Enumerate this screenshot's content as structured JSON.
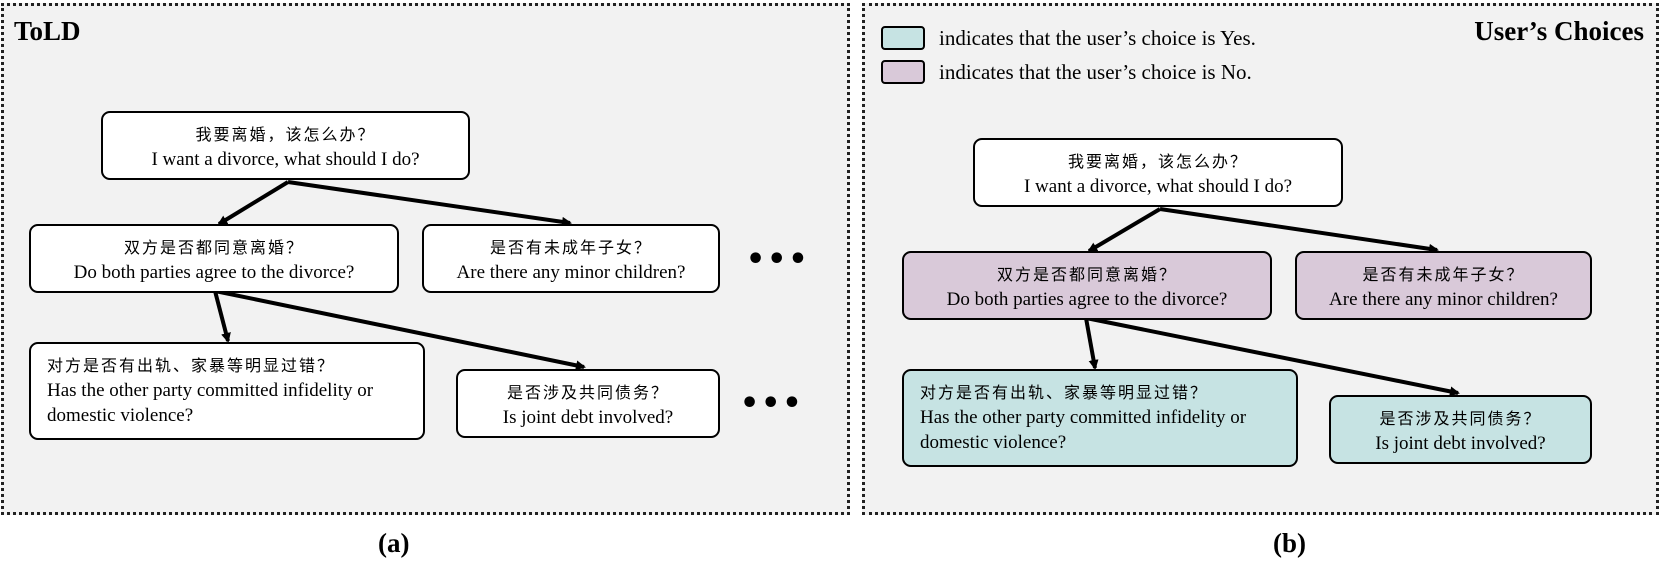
{
  "panel_a": {
    "title": "ToLD",
    "caption": "(a)",
    "nodes": {
      "root": {
        "zh": "我要离婚，该怎么办？",
        "en": "I want a divorce, what should I do?"
      },
      "agree": {
        "zh": "双方是否都同意离婚？",
        "en": "Do both parties agree to the divorce?"
      },
      "minor": {
        "zh": "是否有未成年子女？",
        "en": "Are there any minor children?"
      },
      "fault": {
        "zh": "对方是否有出轨、家暴等明显过错？",
        "en": "Has the other party committed infidelity or domestic violence?"
      },
      "debt": {
        "zh": "是否涉及共同债务？",
        "en": "Is joint debt involved?"
      }
    },
    "ellipsis": "•••"
  },
  "panel_b": {
    "title": "User’s Choices",
    "caption": "(b)",
    "legend": [
      {
        "text": "indicates that the user’s choice  is Yes.",
        "color": "#c6e3e3"
      },
      {
        "text": "indicates that the user’s choice  is No.",
        "color": "#d9c9d9"
      }
    ],
    "nodes": {
      "root": {
        "zh": "我要离婚，该怎么办？",
        "en": "I want a divorce, what should I do?"
      },
      "agree": {
        "zh": "双方是否都同意离婚？",
        "en": "Do both parties agree to the divorce?"
      },
      "minor": {
        "zh": "是否有未成年子女？",
        "en": "Are there any minor children?"
      },
      "fault": {
        "zh": "对方是否有出轨、家暴等明显过错？",
        "en": "Has the other party committed infidelity or domestic violence?"
      },
      "debt": {
        "zh": "是否涉及共同债务？",
        "en": "Is joint debt involved?"
      }
    }
  }
}
